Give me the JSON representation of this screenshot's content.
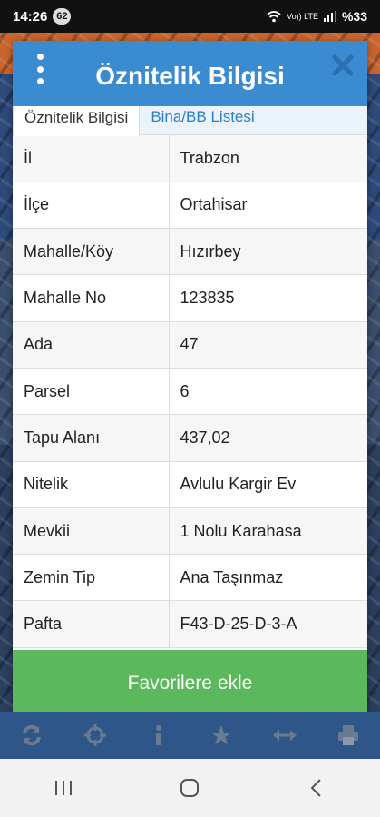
{
  "status": {
    "time": "14:26",
    "badge": "62",
    "network": "Vo)) LTE",
    "battery": "%33"
  },
  "modal": {
    "title": "Öznitelik Bilgisi",
    "tabs": [
      {
        "label": "Öznitelik Bilgisi",
        "active": true
      },
      {
        "label": "Bina/BB Listesi",
        "active": false
      }
    ],
    "rows": [
      {
        "key": "İl",
        "value": "Trabzon"
      },
      {
        "key": "İlçe",
        "value": "Ortahisar"
      },
      {
        "key": "Mahalle/Köy",
        "value": "Hızırbey"
      },
      {
        "key": "Mahalle No",
        "value": "123835"
      },
      {
        "key": "Ada",
        "value": "47"
      },
      {
        "key": "Parsel",
        "value": "6"
      },
      {
        "key": "Tapu Alanı",
        "value": "437,02"
      },
      {
        "key": "Nitelik",
        "value": "Avlulu Kargir Ev"
      },
      {
        "key": "Mevkii",
        "value": "1 Nolu Karahasa"
      },
      {
        "key": "Zemin Tip",
        "value": "Ana Taşınmaz"
      },
      {
        "key": "Pafta",
        "value": "F43-D-25-D-3-A"
      }
    ],
    "favorite_label": "Favorilere ekle"
  },
  "toolbar": {
    "icons": [
      "refresh-icon",
      "crosshair-icon",
      "info-icon",
      "star-icon",
      "measure-icon",
      "print-icon"
    ]
  },
  "colors": {
    "header": "#3b8bd1",
    "tab_link": "#2a7fc8",
    "favorite": "#5cb85c",
    "toolbar": "#2e5688"
  }
}
